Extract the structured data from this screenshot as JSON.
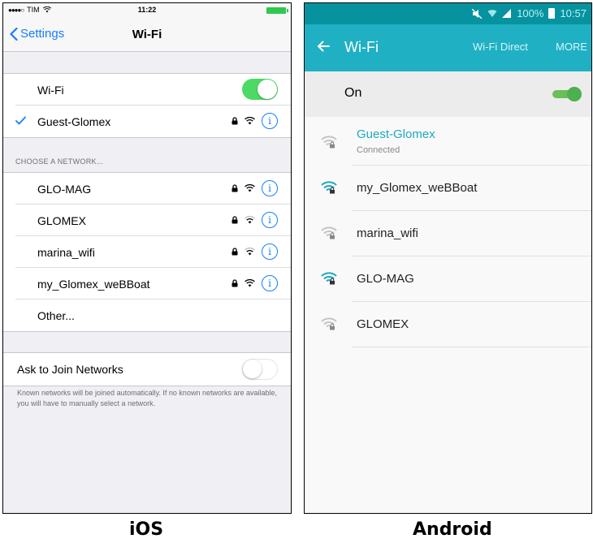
{
  "ios": {
    "status": {
      "carrier": "TIM",
      "time": "11:22"
    },
    "nav": {
      "back_label": "Settings",
      "title": "Wi-Fi"
    },
    "wifi_toggle": {
      "label": "Wi-Fi",
      "state": "on"
    },
    "connected_network": {
      "name": "Guest-Glomex"
    },
    "section_header": "CHOOSE A NETWORK...",
    "networks": [
      {
        "name": "GLO-MAG"
      },
      {
        "name": "GLOMEX"
      },
      {
        "name": "marina_wifi"
      },
      {
        "name": "my_Glomex_weBBoat"
      }
    ],
    "other_label": "Other...",
    "ask_to_join": {
      "label": "Ask to Join Networks",
      "state": "off"
    },
    "footer_text": "Known networks will be joined automatically. If no known networks are available, you will have to manually select a network.",
    "caption": "iOS",
    "colors": {
      "accent": "#157efb",
      "toggle_on": "#4cd964"
    }
  },
  "android": {
    "status": {
      "battery": "100%",
      "time": "10:57"
    },
    "toolbar": {
      "title": "Wi-Fi",
      "wifi_direct": "Wi-Fi Direct",
      "more": "MORE"
    },
    "on_row": {
      "label": "On",
      "state": "on"
    },
    "networks": [
      {
        "name": "Guest-Glomex",
        "status": "Connected",
        "signal": "weak"
      },
      {
        "name": "my_Glomex_weBBoat",
        "status": "",
        "signal": "strong"
      },
      {
        "name": "marina_wifi",
        "status": "",
        "signal": "weak"
      },
      {
        "name": "GLO-MAG",
        "status": "",
        "signal": "strong"
      },
      {
        "name": "GLOMEX",
        "status": "",
        "signal": "weak"
      }
    ],
    "caption": "Android",
    "colors": {
      "toolbar": "#1fb0c3",
      "status_bar": "#06939f",
      "connected_text": "#1fa8bf"
    }
  }
}
